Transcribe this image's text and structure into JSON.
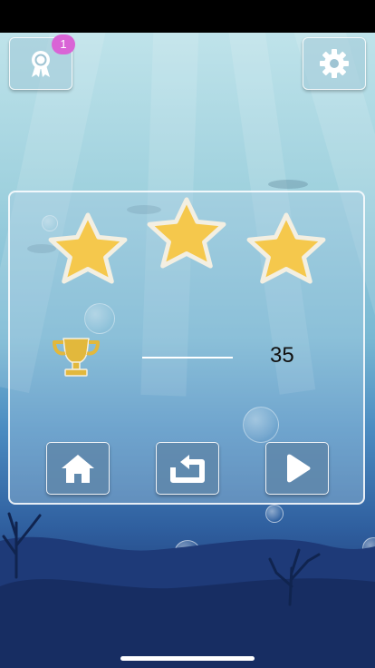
{
  "app": {
    "screen": "level-complete"
  },
  "achievements": {
    "badge_count": "1",
    "icon": "ribbon-award-icon"
  },
  "settings": {
    "icon": "gear-icon"
  },
  "result": {
    "stars_earned": 3,
    "stars_total": 3,
    "best_icon": "trophy-icon",
    "score": "35"
  },
  "actions": {
    "home_icon": "home-icon",
    "restart_icon": "restart-icon",
    "next_icon": "play-icon"
  },
  "colors": {
    "star": "#f5c84c",
    "star_outline": "#f3efe2",
    "trophy": "#e2b83c",
    "badge": "#d964d6"
  }
}
